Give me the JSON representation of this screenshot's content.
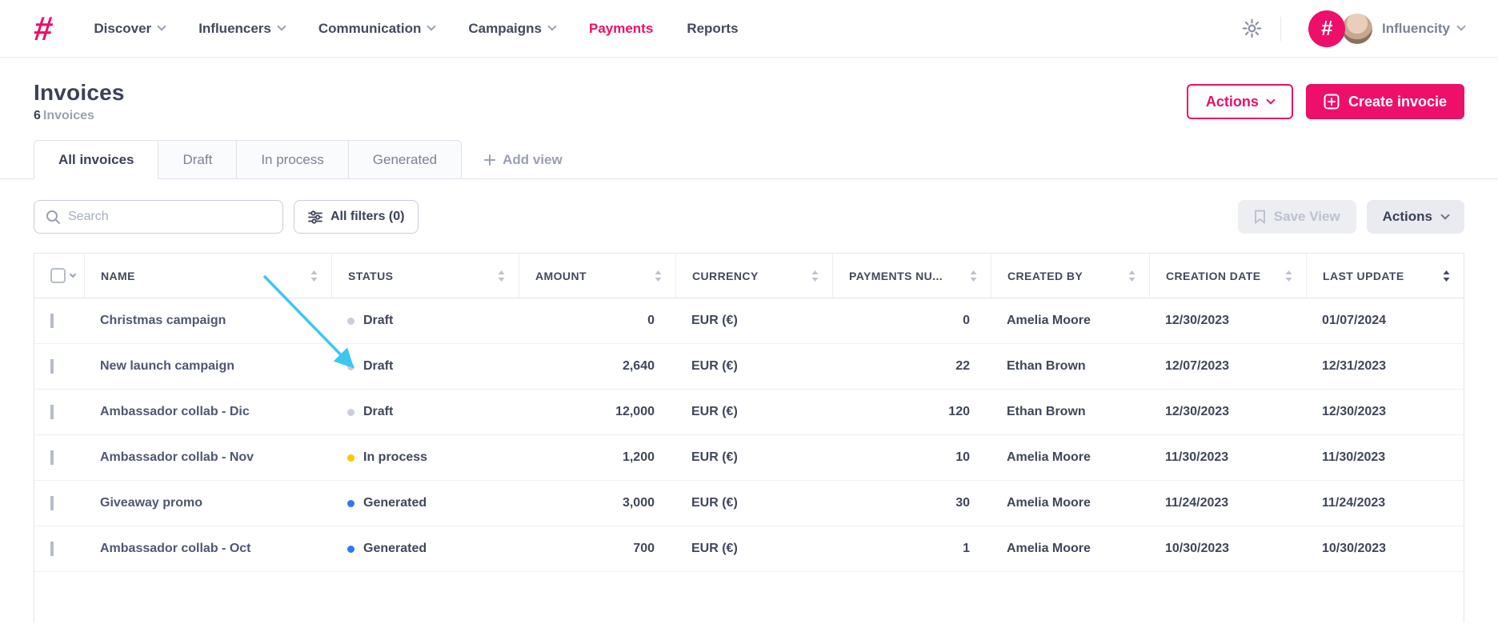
{
  "accent": "#ED0F69",
  "annotation_color": "#3CC7F1",
  "nav": {
    "logo_glyph": "#",
    "items": [
      {
        "label": "Discover",
        "dropdown": true,
        "active": false
      },
      {
        "label": "Influencers",
        "dropdown": true,
        "active": false
      },
      {
        "label": "Communication",
        "dropdown": true,
        "active": false
      },
      {
        "label": "Campaigns",
        "dropdown": true,
        "active": false
      },
      {
        "label": "Payments",
        "dropdown": false,
        "active": true
      },
      {
        "label": "Reports",
        "dropdown": false,
        "active": false
      }
    ],
    "account_name": "Influencity"
  },
  "page": {
    "title": "Invoices",
    "count": "6",
    "count_suffix": "Invoices",
    "actions_button": "Actions",
    "create_button": "Create invocie"
  },
  "tabs": {
    "items": [
      {
        "label": "All invoices",
        "active": true
      },
      {
        "label": "Draft",
        "active": false
      },
      {
        "label": "In process",
        "active": false
      },
      {
        "label": "Generated",
        "active": false
      }
    ],
    "add_view": "Add view"
  },
  "toolbar": {
    "search_placeholder": "Search",
    "filters_button": "All filters (0)",
    "save_view_button": "Save View",
    "actions_button": "Actions"
  },
  "status_colors": {
    "Draft": "#C9CEDA",
    "In process": "#FFC400",
    "Generated": "#2979FF"
  },
  "table": {
    "columns": [
      {
        "label": "NAME",
        "sorted": false
      },
      {
        "label": "STATUS",
        "sorted": false
      },
      {
        "label": "AMOUNT",
        "sorted": false
      },
      {
        "label": "CURRENCY",
        "sorted": false
      },
      {
        "label": "PAYMENTS NU...",
        "sorted": false
      },
      {
        "label": "CREATED BY",
        "sorted": false
      },
      {
        "label": "CREATION DATE",
        "sorted": false
      },
      {
        "label": "LAST UPDATE",
        "sorted": true
      }
    ],
    "rows": [
      {
        "name": "Christmas campaign",
        "status": "Draft",
        "amount": "0",
        "currency": "EUR (€)",
        "payments_number": "0",
        "created_by": "Amelia Moore",
        "creation_date": "12/30/2023",
        "last_update": "01/07/2024"
      },
      {
        "name": "New launch campaign",
        "status": "Draft",
        "amount": "2,640",
        "currency": "EUR (€)",
        "payments_number": "22",
        "created_by": "Ethan Brown",
        "creation_date": "12/07/2023",
        "last_update": "12/31/2023"
      },
      {
        "name": "Ambassador collab - Dic",
        "status": "Draft",
        "amount": "12,000",
        "currency": "EUR (€)",
        "payments_number": "120",
        "created_by": "Ethan Brown",
        "creation_date": "12/30/2023",
        "last_update": "12/30/2023"
      },
      {
        "name": "Ambassador collab - Nov",
        "status": "In process",
        "amount": "1,200",
        "currency": "EUR (€)",
        "payments_number": "10",
        "created_by": "Amelia Moore",
        "creation_date": "11/30/2023",
        "last_update": "11/30/2023"
      },
      {
        "name": "Giveaway promo",
        "status": "Generated",
        "amount": "3,000",
        "currency": "EUR (€)",
        "payments_number": "30",
        "created_by": "Amelia Moore",
        "creation_date": "11/24/2023",
        "last_update": "11/24/2023"
      },
      {
        "name": "Ambassador collab - Oct",
        "status": "Generated",
        "amount": "700",
        "currency": "EUR (€)",
        "payments_number": "1",
        "created_by": "Amelia Moore",
        "creation_date": "10/30/2023",
        "last_update": "10/30/2023"
      }
    ]
  }
}
